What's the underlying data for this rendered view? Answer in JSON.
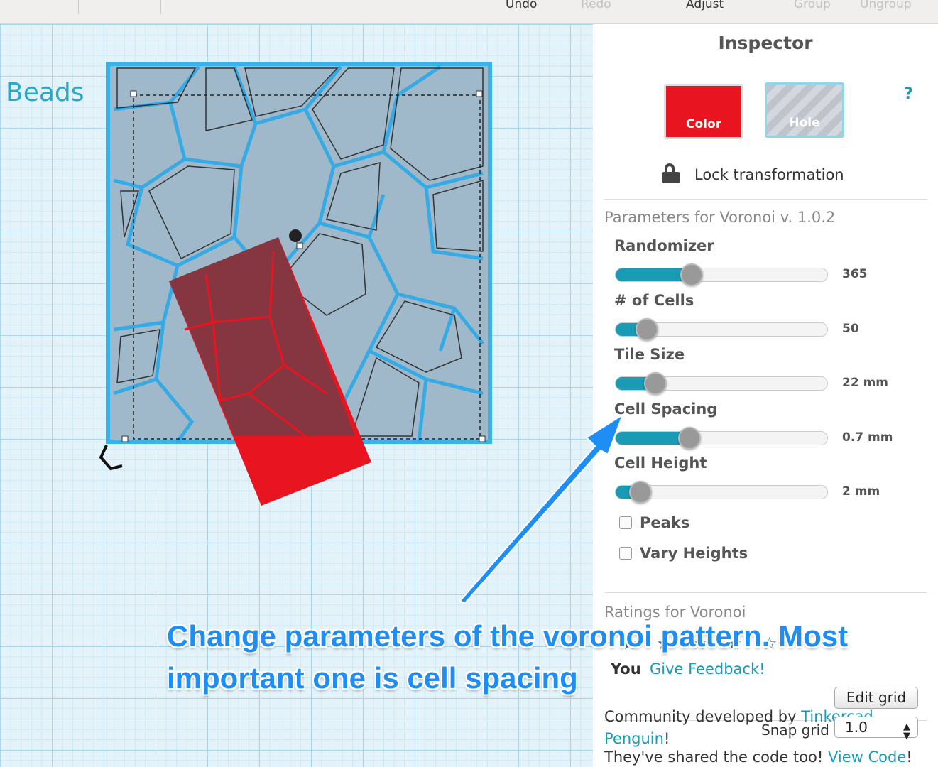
{
  "toolbar": {
    "undo": "Undo",
    "redo": "Redo",
    "adjust": "Adjust",
    "group": "Group",
    "ungroup": "Ungroup"
  },
  "canvas": {
    "object_label": "Beads"
  },
  "inspector": {
    "title": "Inspector",
    "color_label": "Color",
    "hole_label": "Hole",
    "help": "?",
    "lock_label": "Lock transformation",
    "params_heading": "Parameters for Voronoi v. 1.0.2",
    "params": [
      {
        "label": "Randomizer",
        "value": "365",
        "fraction": 0.36
      },
      {
        "label": "# of Cells",
        "value": "50",
        "fraction": 0.15
      },
      {
        "label": "Tile Size",
        "value": "22 mm",
        "fraction": 0.19
      },
      {
        "label": "Cell Spacing",
        "value": "0.7 mm",
        "fraction": 0.35
      },
      {
        "label": "Cell Height",
        "value": "2 mm",
        "fraction": 0.12
      }
    ],
    "checkboxes": [
      {
        "label": "Peaks",
        "checked": false
      },
      {
        "label": "Vary Heights",
        "checked": false
      }
    ],
    "ratings_heading": "Ratings for Voronoi",
    "you_label": "You",
    "feedback_link": "Give Feedback!",
    "community_text": "Community developed by ",
    "author_link": "Tinkercad Penguin",
    "excl": "!",
    "shared_text": "They've shared the code too! ",
    "code_link": "View Code",
    "excl2": "!"
  },
  "grid": {
    "edit_grid": "Edit grid",
    "snap_label": "Snap grid",
    "snap_value": "1.0"
  },
  "annotation": {
    "line1": "Change parameters of the voronoi pattern. Most",
    "line2": "important one is cell spacing"
  },
  "colors": {
    "accent": "#1a9bb5",
    "shape_color": "#e8141f",
    "annotation": "#1e8ef5"
  }
}
